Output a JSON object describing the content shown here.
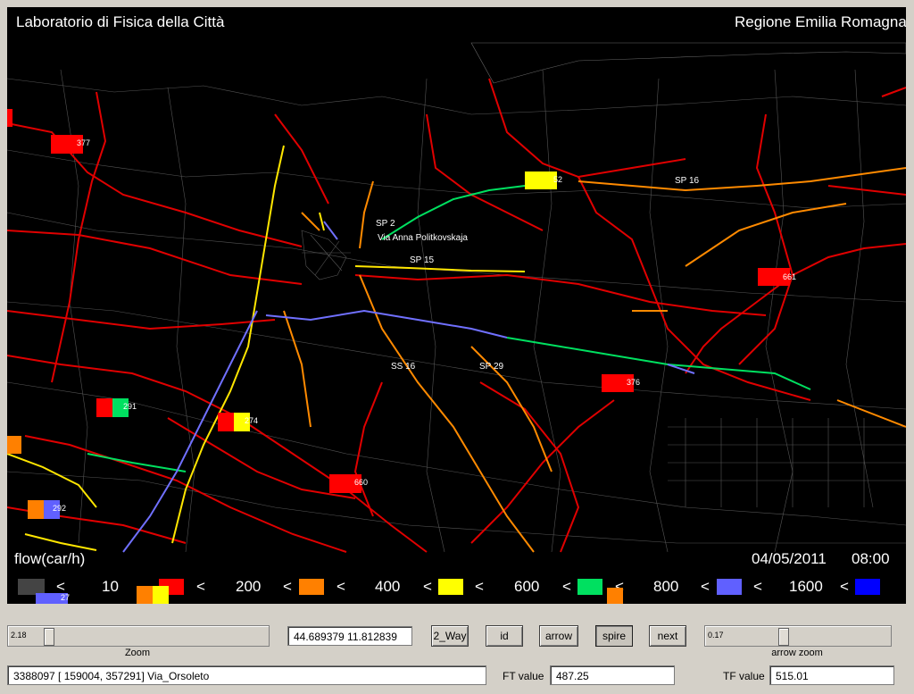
{
  "header": {
    "title_left": "Laboratorio di Fisica della Città",
    "title_right": "Regione Emilia Romagna"
  },
  "map": {
    "roads": [
      {
        "name": "SP 2",
        "label": "SP 2"
      },
      {
        "name": "Via Anna Politkovskaja",
        "label": "Via Anna Politkovskaja"
      },
      {
        "name": "SP 15",
        "label": "SP 15"
      },
      {
        "name": "SP 16",
        "label": "SP 16"
      },
      {
        "name": "SS 16",
        "label": "SS 16"
      },
      {
        "name": "SP 29",
        "label": "SP 29"
      }
    ],
    "sensors": [
      {
        "label": "377",
        "colors": [
          "#ff0000"
        ]
      },
      {
        "label": "52",
        "colors": [
          "#ffff00"
        ]
      },
      {
        "label": "661",
        "colors": [
          "#ff0000"
        ]
      },
      {
        "label": "376",
        "colors": [
          "#ff0000"
        ]
      },
      {
        "label": "291",
        "colors": [
          "#ff0000",
          "#00e060"
        ]
      },
      {
        "label": "274",
        "colors": [
          "#ff0000",
          "#ffff00"
        ]
      },
      {
        "label": "660",
        "colors": [
          "#ff0000"
        ]
      },
      {
        "label": "292",
        "colors": [
          "#ff8000",
          "#6060ff"
        ]
      },
      {
        "label": "27",
        "colors": [
          "#6060ff"
        ]
      }
    ]
  },
  "footer": {
    "flow_label": "flow(car/h)",
    "date": "04/05/2011",
    "time": "08:00"
  },
  "legend": {
    "colors": {
      "gray": "#444444",
      "red": "#ff0000",
      "orange": "#ff8000",
      "yellow": "#ffff00",
      "green": "#00e060",
      "lavender": "#6060ff",
      "blue": "#0000ff"
    },
    "lt": "<",
    "thresholds": [
      "10",
      "200",
      "400",
      "600",
      "800",
      "1600"
    ]
  },
  "controls": {
    "zoom": {
      "value": "2.18",
      "label": "Zoom"
    },
    "coords": "44.689379  11.812839",
    "buttons": {
      "two_way": "2_Way",
      "id": "id",
      "arrow": "arrow",
      "spire": "spire",
      "next": "next"
    },
    "arrow_zoom": {
      "value": "0.17",
      "label": "arrow zoom"
    },
    "info": "3388097  [ 159004, 357291] Via_Orsoleto",
    "ft_label": "FT value",
    "ft_value": "487.25",
    "tf_label": "TF value",
    "tf_value": "515.01"
  }
}
